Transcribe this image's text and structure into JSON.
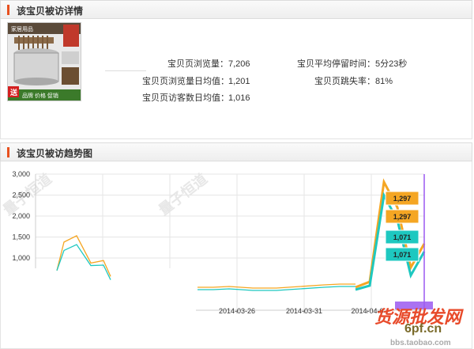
{
  "detail_panel": {
    "title": "该宝贝被访详情",
    "stats": [
      {
        "label": "宝贝页浏览量：",
        "value": "7,206"
      },
      {
        "label": "宝贝页浏览量日均值：",
        "value": "1,201"
      },
      {
        "label": "宝贝页访客数日均值：",
        "value": "1,016"
      },
      {
        "label": "宝贝平均停留时间：",
        "value": "5分23秒"
      },
      {
        "label": "宝贝页跳失率：",
        "value": "81%"
      }
    ],
    "product_image_text": {
      "top_label": "家居用品",
      "badge": "送",
      "banner": "品牌 价格 促销"
    }
  },
  "trend_panel": {
    "title": "该宝贝被访趋势图"
  },
  "chart_data": {
    "type": "line",
    "y_ticks": [
      "3,000",
      "2,500",
      "2,000",
      "1,500",
      "1,000"
    ],
    "x_ticks": [
      "2014-03-26",
      "2014-03-31",
      "2014-04-0"
    ],
    "ylim": [
      0,
      3000
    ],
    "grid": true,
    "series": [
      {
        "color": "#f5a623",
        "values": [
          {
            "x": 0,
            "y": 700
          },
          {
            "x": 1,
            "y": 1380
          },
          {
            "x": 2,
            "y": 1530
          },
          {
            "x": 3,
            "y": 880
          },
          {
            "x": 4,
            "y": 940
          },
          {
            "x": 5,
            "y": 560
          },
          {
            "x": 22,
            "y": 240
          },
          {
            "x": 23,
            "y": 500
          },
          {
            "x": 24,
            "y": 2800
          },
          {
            "x": 25,
            "y": 2250
          },
          {
            "x": 26,
            "y": 780
          },
          {
            "x": 27,
            "y": 1300
          }
        ]
      },
      {
        "color": "#1ec8c0",
        "values": [
          {
            "x": 0,
            "y": 700
          },
          {
            "x": 1,
            "y": 1180
          },
          {
            "x": 2,
            "y": 1320
          },
          {
            "x": 3,
            "y": 820
          },
          {
            "x": 4,
            "y": 830
          },
          {
            "x": 5,
            "y": 480
          },
          {
            "x": 22,
            "y": 200
          },
          {
            "x": 23,
            "y": 400
          },
          {
            "x": 24,
            "y": 2420
          },
          {
            "x": 25,
            "y": 1900
          },
          {
            "x": 26,
            "y": 560
          },
          {
            "x": 27,
            "y": 1071
          }
        ]
      }
    ],
    "flat_segment": {
      "orange_y": 230,
      "teal_y": 200
    },
    "data_labels": [
      {
        "text": "1,297",
        "series": 0
      },
      {
        "text": "1,297",
        "series": 0
      },
      {
        "text": "1,071",
        "series": 1
      },
      {
        "text": "1,071",
        "series": 1
      }
    ]
  },
  "watermarks": {
    "wm1": "量子恒道",
    "wm2": "量子恒道",
    "site1": "货源批发网",
    "site2": "6pf.cn",
    "site3": "bbs.taobao.com"
  },
  "colors": {
    "accent_bar": "#e8501e",
    "orange": "#f5a623",
    "teal": "#1ec8c0",
    "cursor": "#9b59f0"
  }
}
